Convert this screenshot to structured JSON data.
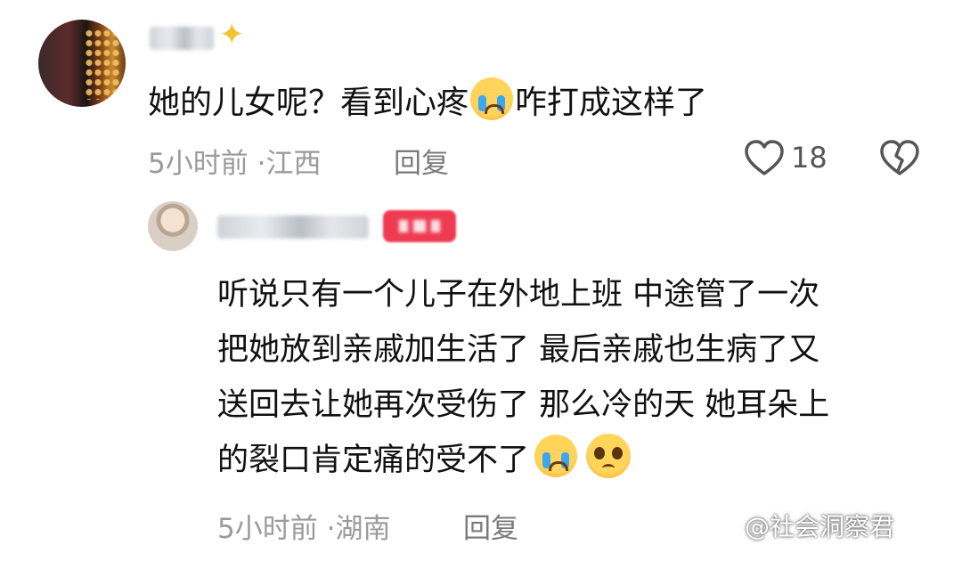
{
  "comment": {
    "username_obscured": true,
    "text_before": "她的儿女呢？看到心疼",
    "emoji_1": "crying-face",
    "text_after": "咋打成这样了",
    "time": "5小时前",
    "separator": "·",
    "location": "江西",
    "reply_label": "回复",
    "like_count": "18"
  },
  "reply": {
    "username_obscured": true,
    "lines": [
      "听说只有一个儿子在外地上班 中途管了一次",
      "把她放到亲戚加生活了 最后亲戚也生病了又",
      "送回去让她再次受伤了 那么冷的天 她耳朵上",
      "的裂口肯定痛的受不了"
    ],
    "end_emojis": [
      "crying-face",
      "pleading-face"
    ],
    "time": "5小时前",
    "separator": "·",
    "location": "湖南",
    "reply_label": "回复"
  },
  "watermark": "@社会洞察君",
  "colors": {
    "badge": "#ef3b52",
    "meta_text": "#9a9a9a",
    "icon_stroke": "#555555"
  }
}
